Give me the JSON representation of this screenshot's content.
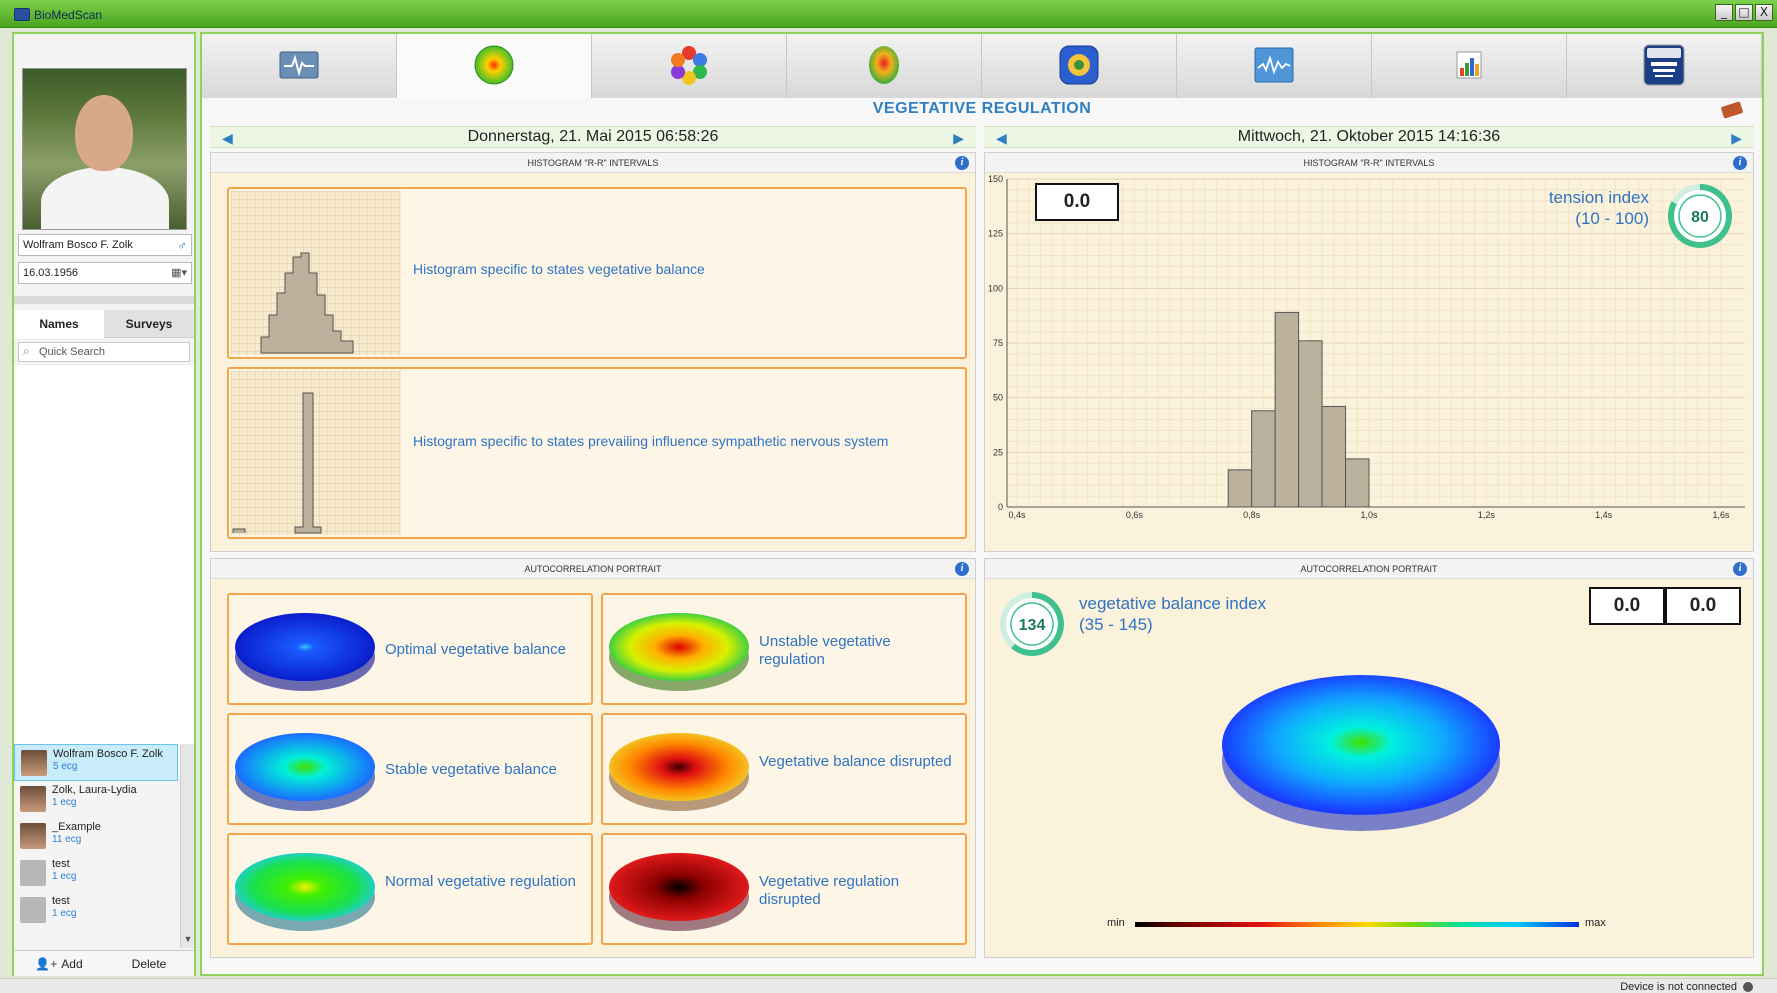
{
  "window": {
    "title": "BioMedScan",
    "minimize": "_",
    "maximize": "□",
    "close": "X"
  },
  "sidebar": {
    "patient_name": "Wolfram Bosco F. Zolk",
    "birth_date": "16.03.1956",
    "tabs": [
      {
        "label": "Names"
      },
      {
        "label": "Surveys"
      }
    ],
    "search_placeholder": "Quick Search",
    "patients": [
      {
        "name": "Wolfram Bosco F. Zolk",
        "count": "5 ecg"
      },
      {
        "name": "Zolk, Laura-Lydia",
        "count": "1 ecg"
      },
      {
        "name": "_Example",
        "count": "11 ecg"
      },
      {
        "name": "test",
        "count": "1 ecg"
      },
      {
        "name": "test",
        "count": "1 ecg"
      }
    ],
    "add_label": "Add",
    "delete_label": "Delete"
  },
  "nav": {
    "tabs": [
      "ecg-monitor-icon",
      "vegetative-regulation-icon",
      "molecule-icon",
      "heat-map-icon",
      "badge-icon",
      "waveform-icon",
      "bar-chart-icon",
      "biomedscan-logo-icon"
    ],
    "active_index": 1
  },
  "page_title": "VEGETATIVE REGULATION",
  "date_left": "Donnerstag, 21. Mai 2015 06:58:26",
  "date_right": "Mittwoch, 21. Oktober 2015 14:16:36",
  "histogram_left": {
    "header": "HISTOGRAM \"R-R\" INTERVALS",
    "cards": [
      {
        "label": "Histogram specific to states vegetative balance"
      },
      {
        "label": "Histogram specific to states prevailing influence sympathetic nervous system"
      }
    ]
  },
  "histogram_right": {
    "header": "HISTOGRAM \"R-R\" INTERVALS",
    "value": "0.0",
    "index_label": "tension index",
    "index_range": "(10 - 100)",
    "index_value": "80"
  },
  "autocorrelation_left": {
    "header": "AUTOCORRELATION PORTRAIT",
    "cards": [
      {
        "label": "Optimal vegetative balance"
      },
      {
        "label": "Unstable vegetative regulation"
      },
      {
        "label": "Stable vegetative balance"
      },
      {
        "label": "Vegetative balance disrupted"
      },
      {
        "label": "Normal vegetative regulation"
      },
      {
        "label": "Vegetative regulation disrupted"
      }
    ]
  },
  "autocorrelation_right": {
    "header": "AUTOCORRELATION PORTRAIT",
    "value1": "0.0",
    "value2": "0.0",
    "index_label": "vegetative balance index",
    "index_range": "(35 - 145)",
    "index_value": "134",
    "colorbar_min": "min",
    "colorbar_max": "max"
  },
  "status": "Device is not connected",
  "chart_data": {
    "type": "bar",
    "title": "HISTOGRAM \"R-R\" INTERVALS",
    "x": [
      "0,4s",
      "0,6s",
      "0,8s",
      "1,0s",
      "1,2s",
      "1,4s",
      "1,6s"
    ],
    "y_ticks": [
      0,
      25,
      50,
      75,
      100,
      125,
      150
    ],
    "ylim": [
      0,
      150
    ],
    "xlim": [
      0.4,
      1.6
    ],
    "bins": [
      {
        "x0": 0.76,
        "x1": 0.8,
        "value": 17
      },
      {
        "x0": 0.8,
        "x1": 0.84,
        "value": 44
      },
      {
        "x0": 0.84,
        "x1": 0.88,
        "value": 89
      },
      {
        "x0": 0.88,
        "x1": 0.92,
        "value": 76
      },
      {
        "x0": 0.92,
        "x1": 0.96,
        "value": 46
      },
      {
        "x0": 0.96,
        "x1": 1.0,
        "value": 22
      }
    ],
    "grid": true
  },
  "colors": {
    "accent": "#2f7fc1",
    "frame_green": "#8fd35d",
    "card_border": "#f0a64b"
  }
}
